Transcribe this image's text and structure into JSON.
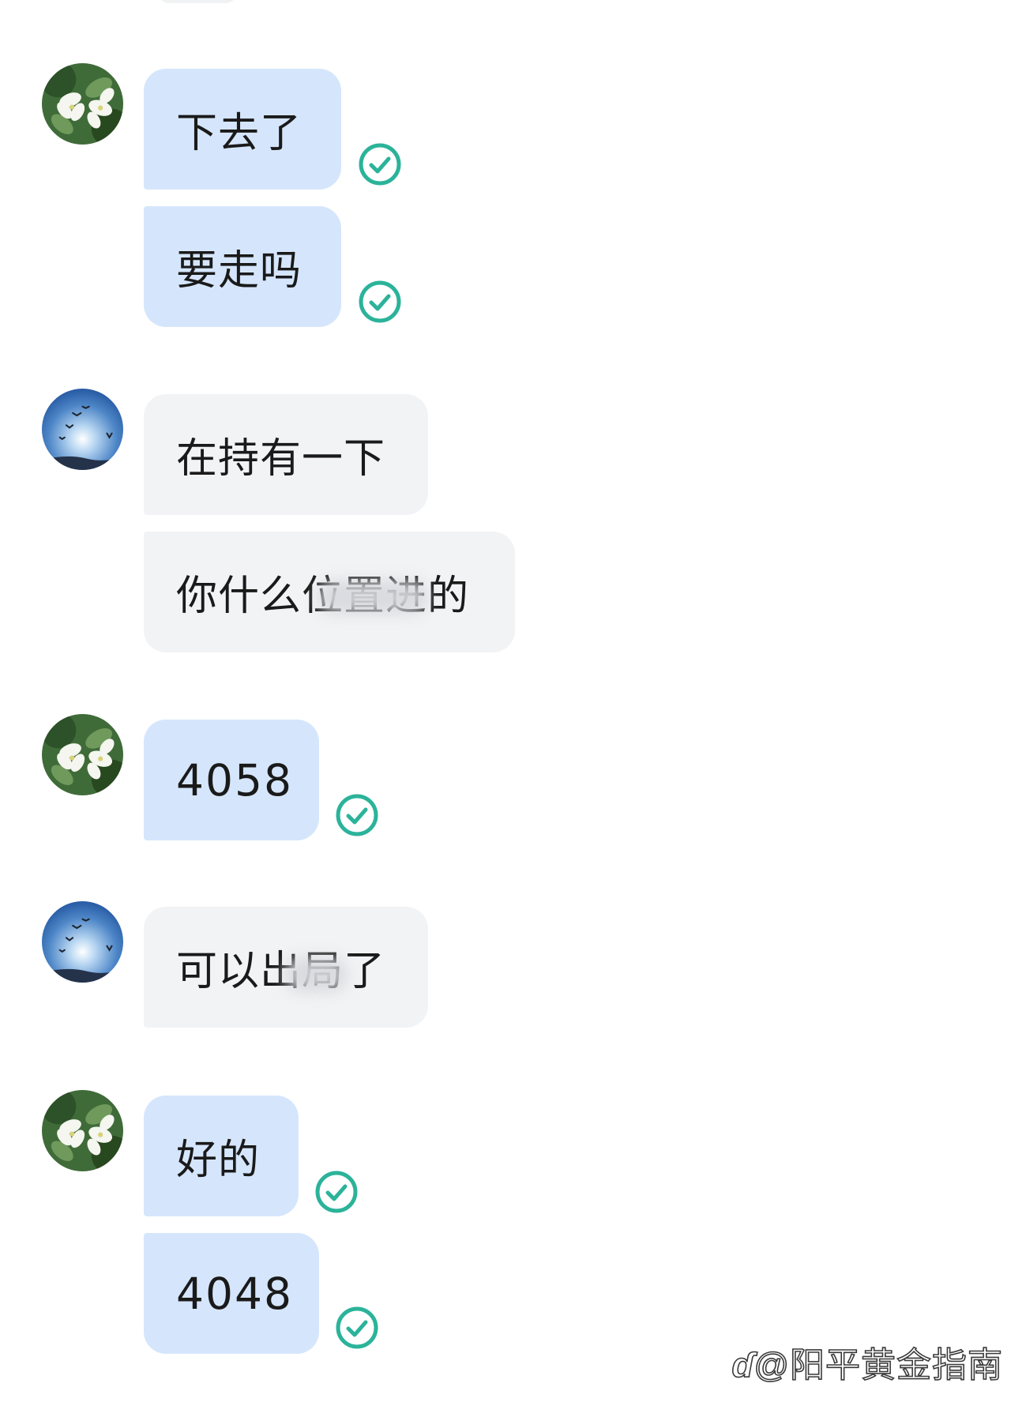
{
  "messages": [
    {
      "text": "下去了",
      "sender": "self",
      "read": true
    },
    {
      "text": "要走吗",
      "sender": "self",
      "read": true
    },
    {
      "text": "在持有一下",
      "sender": "other"
    },
    {
      "text": "你什么位置进的",
      "sender": "other"
    },
    {
      "text": "4058",
      "sender": "self",
      "read": true
    },
    {
      "text": "可以出局了",
      "sender": "other"
    },
    {
      "text": "好的",
      "sender": "self",
      "read": true
    },
    {
      "text": "4048",
      "sender": "self",
      "read": true
    }
  ],
  "avatars": {
    "self": "white-flowers-avatar",
    "other": "sky-birds-avatar"
  },
  "icons": {
    "read_receipt": "check-circle-icon"
  },
  "colors": {
    "self_bubble": "#d5e6fc",
    "other_bubble": "#f2f3f5",
    "read_check": "#2bb39a"
  },
  "watermark": {
    "logo": "ɗ",
    "text": "@阳平黄金指南"
  }
}
